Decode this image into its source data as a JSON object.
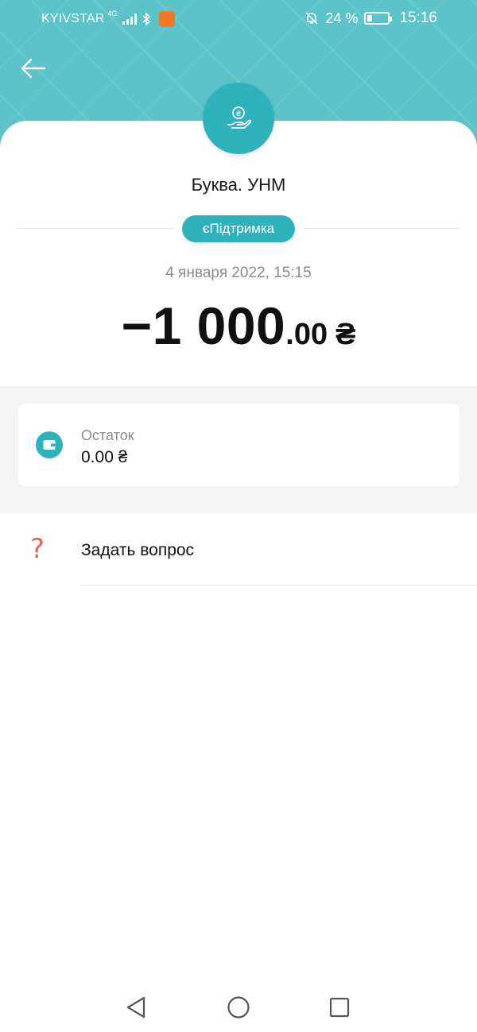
{
  "status_bar": {
    "carrier": "KYIVSTAR",
    "network": "4G",
    "battery_percent": "24 %",
    "battery_level": 0.24,
    "time": "15:16",
    "icons": [
      "signal-icon",
      "bluetooth-icon",
      "app-notification-icon",
      "bell-off-icon",
      "battery-icon"
    ]
  },
  "header": {
    "back_icon": "arrow-left-icon",
    "accent_color": "#5cc3c9"
  },
  "transaction": {
    "merchant_icon": "hand-coin-icon",
    "merchant_name": "Буква. УНМ",
    "category": "єПідтримка",
    "date": "4 января 2022, 15:15",
    "amount_main": "−1 000",
    "amount_decimals": ".00",
    "currency": "₴"
  },
  "balance": {
    "icon": "wallet-icon",
    "label": "Остаток",
    "value": "0.00 ₴"
  },
  "actions": {
    "ask_icon": "question-mark-icon",
    "ask_label": "Задать вопрос"
  },
  "nav_bar": {
    "icons": [
      "back-triangle-icon",
      "home-circle-icon",
      "recents-square-icon"
    ]
  },
  "colors": {
    "brand": "#2eb3bd",
    "question_icon": "#ea6552"
  }
}
